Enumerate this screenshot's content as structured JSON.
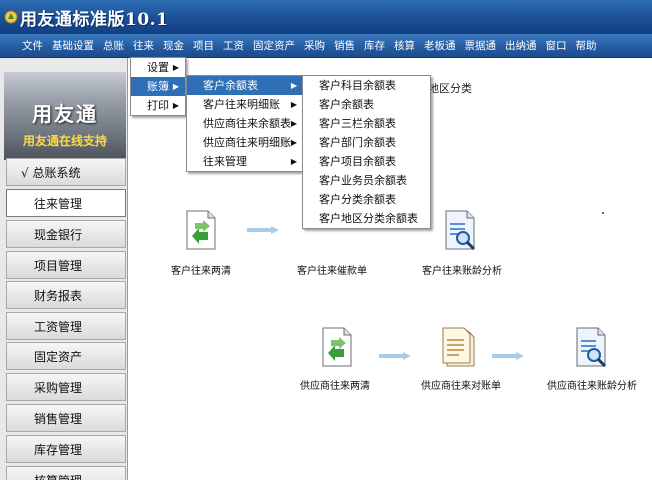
{
  "window": {
    "title": "用友通标准版10.1"
  },
  "menubar": {
    "items": [
      "文件",
      "基础设置",
      "总账",
      "往来",
      "现金",
      "项目",
      "工资",
      "固定资产",
      "采购",
      "销售",
      "库存",
      "核算",
      "老板通",
      "票据通",
      "出纳通",
      "窗口",
      "帮助"
    ]
  },
  "sidebar": {
    "logo": "用友通",
    "support": "用友通在线支持",
    "items": [
      "√ 总账系统",
      "往来管理",
      "现金银行",
      "项目管理",
      "财务报表",
      "工资管理",
      "固定资产",
      "采购管理",
      "销售管理",
      "库存管理",
      "核算管理"
    ]
  },
  "menu1": {
    "items": [
      "设置",
      "账簿",
      "打印"
    ]
  },
  "menu2": {
    "items": [
      "客户余额表",
      "客户往来明细账",
      "供应商往来余额表",
      "供应商往来明细账",
      "往来管理"
    ]
  },
  "menu3": {
    "items": [
      "客户科目余额表",
      "客户余额表",
      "客户三栏余额表",
      "客户部门余额表",
      "客户项目余额表",
      "客户业务员余额表",
      "客户分类余额表",
      "客户地区分类余额表"
    ]
  },
  "main": {
    "region_label": "地区分类",
    "row1": [
      "客户往来两清",
      "客户往来催款单",
      "客户往来账龄分析"
    ],
    "row2": [
      "供应商往来两清",
      "供应商往来对账单",
      "供应商往来账龄分析"
    ]
  },
  "colors": {
    "titlebar": "#1a4f97",
    "menubar": "#245a9f",
    "highlight": "#2f6fb5",
    "logo_sub": "#ffd84a"
  }
}
